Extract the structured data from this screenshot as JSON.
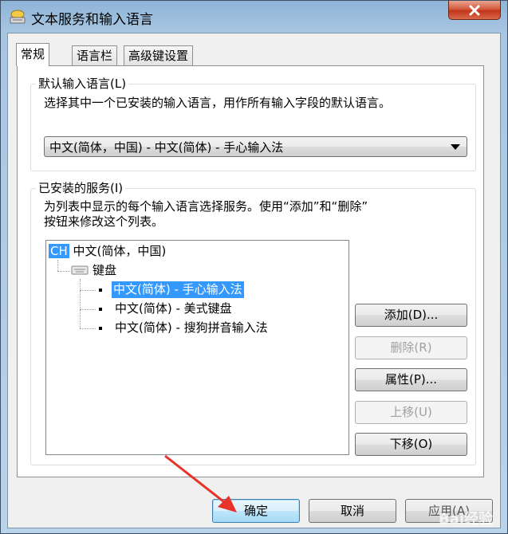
{
  "window": {
    "title": "文本服务和输入语言",
    "icon": "keyboard-language-icon",
    "close_icon": "close-icon"
  },
  "tabs": [
    {
      "label": "常规",
      "active": true
    },
    {
      "label": "语言栏",
      "active": false
    },
    {
      "label": "高级键设置",
      "active": false
    }
  ],
  "default_language": {
    "group_title": "默认输入语言(L)",
    "description": "选择其中一个已安装的输入语言，用作所有输入字段的默认语言。",
    "selected": "中文(简体，中国) - 中文(简体) - 手心输入法"
  },
  "installed_services": {
    "group_title": "已安装的服务(I)",
    "description_line1": "为列表中显示的每个输入语言选择服务。使用“添加”和“删除”",
    "description_line2": "按钮来修改这个列表。",
    "tree": {
      "language_badge": "CH",
      "language": "中文(简体，中国)",
      "category": "键盘",
      "items": [
        {
          "label": "中文(简体) - 手心输入法",
          "selected": true
        },
        {
          "label": "中文(简体) - 美式键盘",
          "selected": false
        },
        {
          "label": "中文(简体) - 搜狗拼音输入法",
          "selected": false
        }
      ]
    },
    "buttons": {
      "add": "添加(D)...",
      "remove": "删除(R)",
      "properties": "属性(P)...",
      "move_up": "上移(U)",
      "move_down": "下移(O)"
    }
  },
  "footer": {
    "ok": "确定",
    "cancel": "取消",
    "apply": "应用(A)"
  },
  "watermark": "Bai经验",
  "colors": {
    "selection": "#3399ff",
    "annotation_arrow": "#e8332a",
    "close_button": "#c2351b"
  }
}
